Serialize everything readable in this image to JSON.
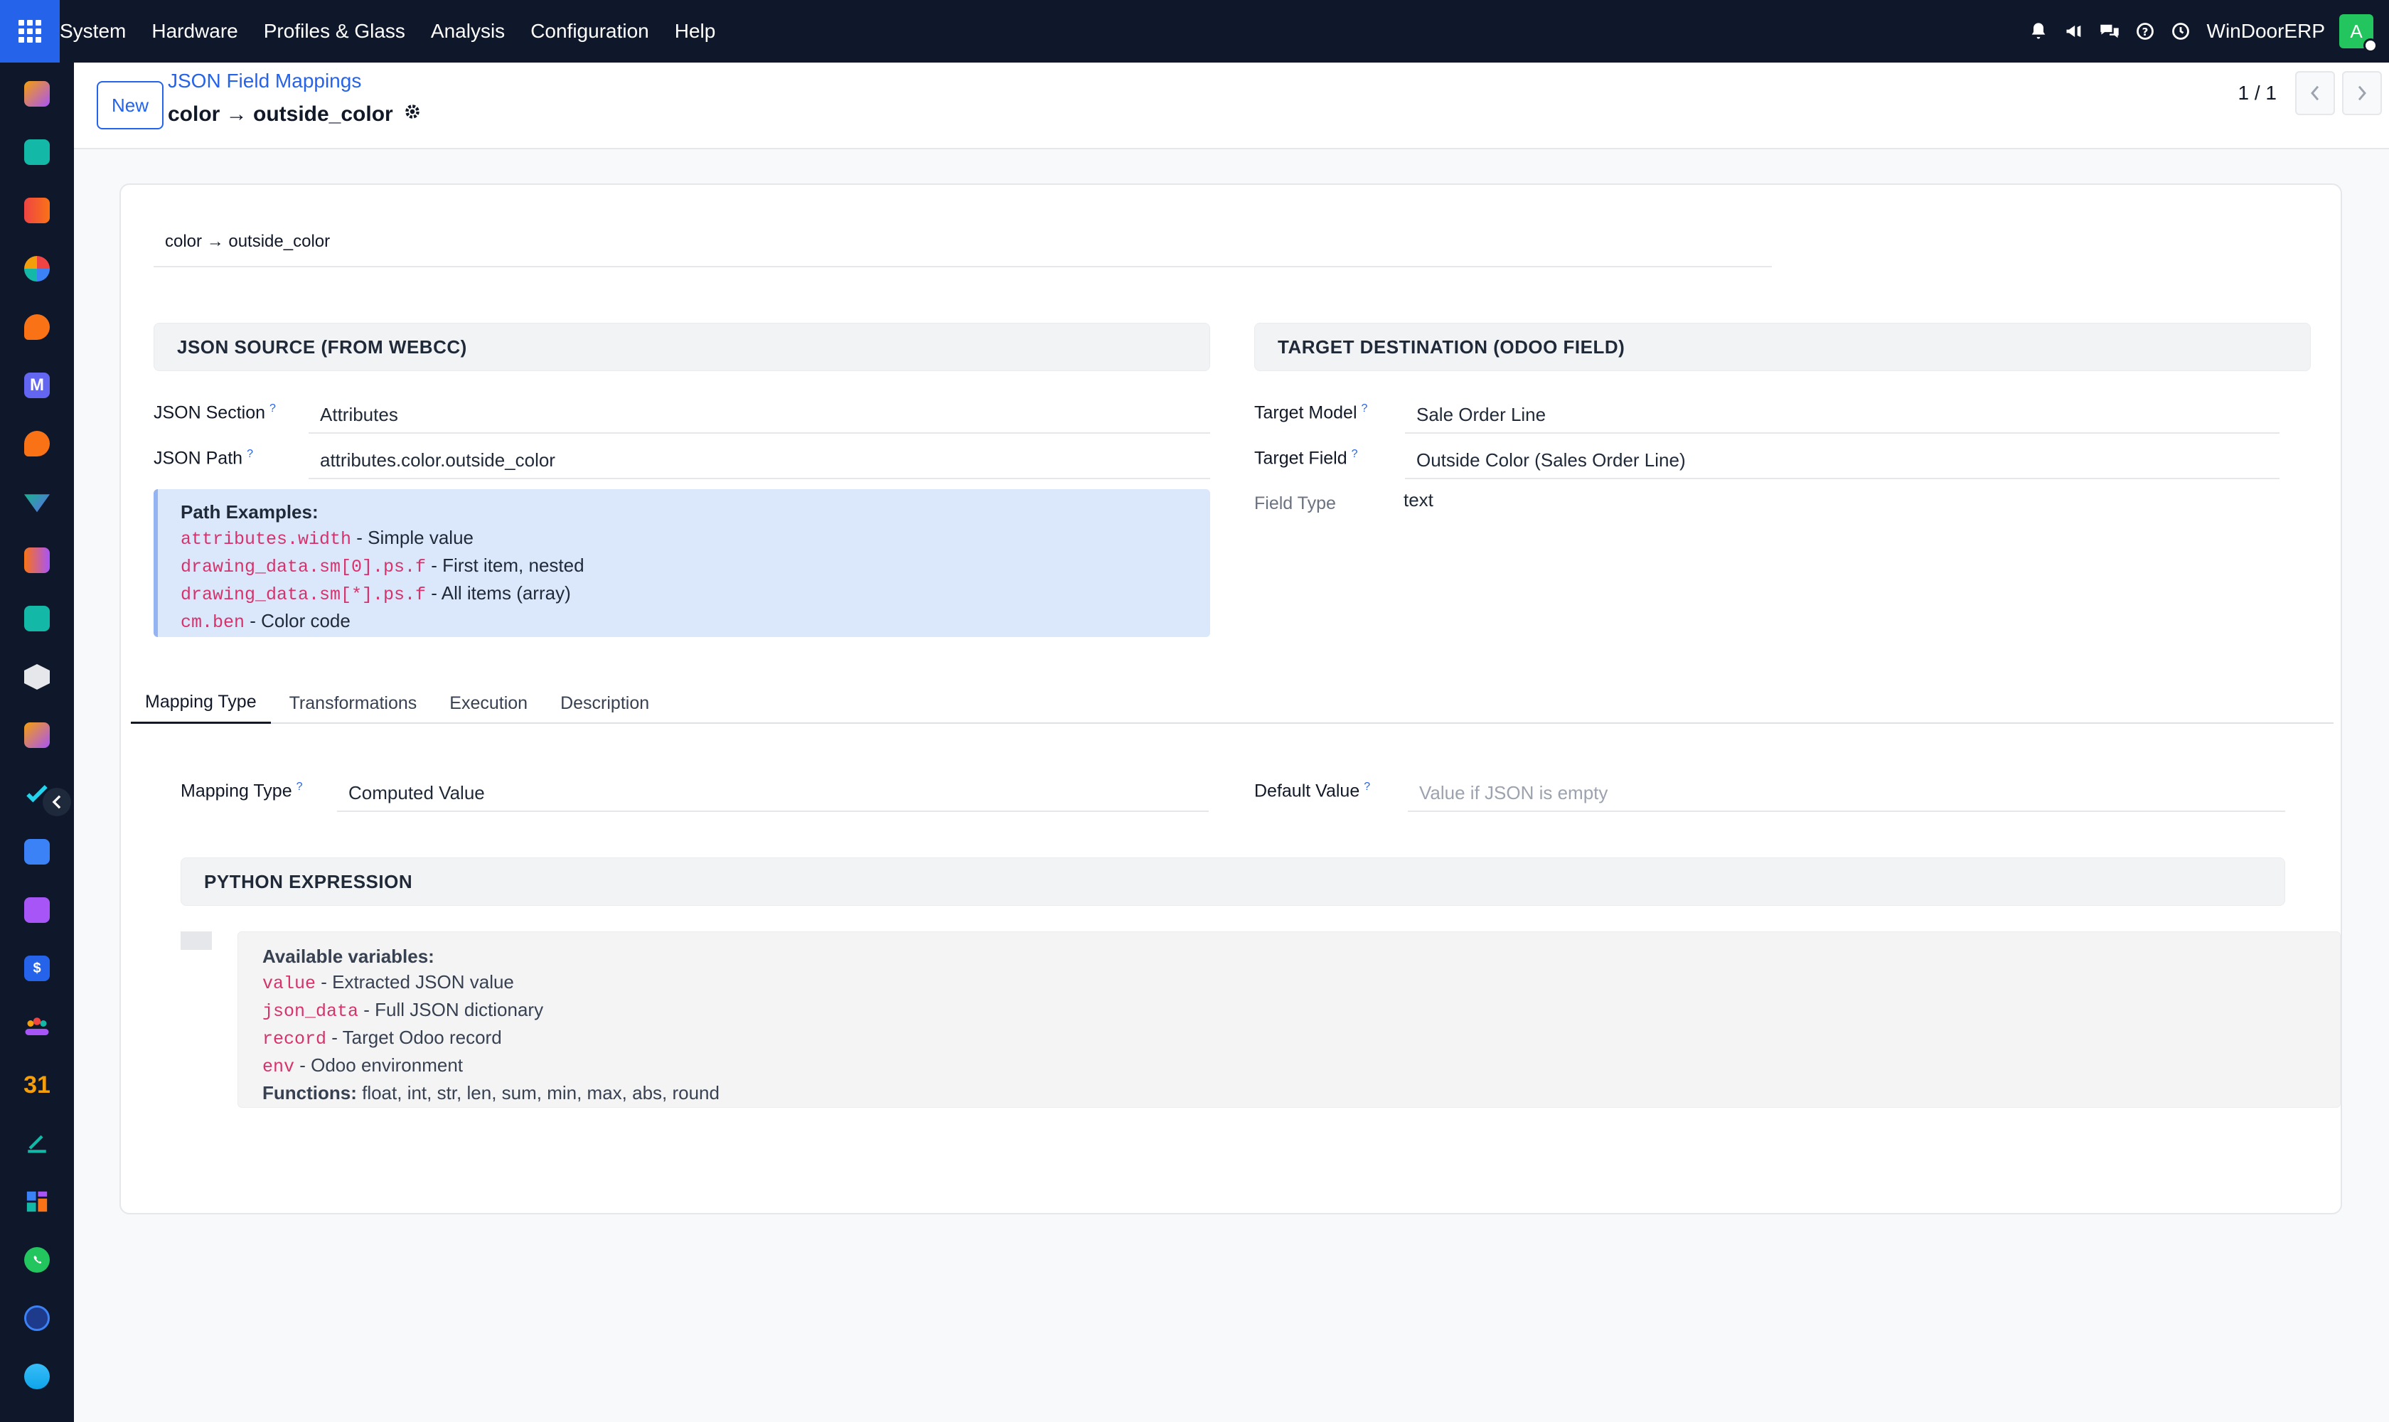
{
  "topbar": {
    "menu": [
      "System",
      "Hardware",
      "Profiles & Glass",
      "Analysis",
      "Configuration",
      "Help"
    ],
    "company": "WinDoorERP",
    "avatar_initial": "A",
    "icons": [
      "bell-icon",
      "megaphone-icon",
      "chat-icon",
      "help-icon",
      "clock-icon"
    ]
  },
  "sidebar": {
    "apps": [
      {
        "name": "app-sales-icon",
        "color": "#f59e0b"
      },
      {
        "name": "app-contacts-icon",
        "color": "#14b8a6"
      },
      {
        "name": "app-reporting-icon",
        "color": "#f97316"
      },
      {
        "name": "app-analytics-icon",
        "color": "#ef4444"
      },
      {
        "name": "app-discuss-icon",
        "color": "#f97316"
      },
      {
        "name": "app-mail-icon",
        "color": "#6366f1"
      },
      {
        "name": "app-livechat-icon",
        "color": "#f97316"
      },
      {
        "name": "app-inventory-icon",
        "color": "#10b981"
      },
      {
        "name": "app-dashboard-icon",
        "color": "#f97316"
      },
      {
        "name": "app-employees-icon",
        "color": "#14b8a6"
      },
      {
        "name": "app-products-icon",
        "color": "#e5e7eb"
      },
      {
        "name": "app-studio-icon",
        "color": "#f59e0b"
      },
      {
        "name": "app-project-icon",
        "color": "#22d3ee"
      },
      {
        "name": "app-knowledge-icon",
        "color": "#3b82f6"
      },
      {
        "name": "app-manufacturing-icon",
        "color": "#a855f7"
      },
      {
        "name": "app-invoicing-icon",
        "color": "#2563eb"
      },
      {
        "name": "app-team-icon",
        "color": "#f59e0b"
      },
      {
        "name": "app-calendar-icon",
        "color": "#f59e0b"
      },
      {
        "name": "app-sign-icon",
        "color": "#14b8a6"
      },
      {
        "name": "app-website-icon",
        "color": "#3b82f6"
      },
      {
        "name": "app-whatsapp-icon",
        "color": "#22c55e"
      },
      {
        "name": "app-timer-icon",
        "color": "#3b82f6"
      },
      {
        "name": "app-swirl-icon",
        "color": "#0ea5e9"
      }
    ],
    "calendar_day": "31"
  },
  "control_panel": {
    "new_label": "New",
    "breadcrumb": "JSON Field Mappings",
    "title": "color → outside_color",
    "pager": "1 / 1"
  },
  "form": {
    "name": "color → outside_color",
    "source": {
      "heading": "JSON SOURCE (FROM WEBCC)",
      "section_label": "JSON Section",
      "section_value": "Attributes",
      "path_label": "JSON Path",
      "path_value": "attributes.color.outside_color",
      "examples_title": "Path Examples:",
      "examples": [
        {
          "code": "attributes.width",
          "desc": " - Simple value"
        },
        {
          "code": "drawing_data.sm[0].ps.f",
          "desc": " - First item, nested"
        },
        {
          "code": "drawing_data.sm[*].ps.f",
          "desc": " - All items (array)"
        },
        {
          "code": "cm.ben",
          "desc": " - Color code"
        }
      ]
    },
    "target": {
      "heading": "TARGET DESTINATION (ODOO FIELD)",
      "model_label": "Target Model",
      "model_value": "Sale Order Line",
      "field_label": "Target Field",
      "field_value": "Outside Color (Sales Order Line)",
      "type_label": "Field Type",
      "type_value": "text"
    },
    "tabs": [
      "Mapping Type",
      "Transformations",
      "Execution",
      "Description"
    ],
    "mapping": {
      "type_label": "Mapping Type",
      "type_value": "Computed Value",
      "default_label": "Default Value",
      "default_placeholder": "Value if JSON is empty",
      "python_heading": "PYTHON EXPRESSION",
      "vars_title": "Available variables:",
      "vars": [
        {
          "code": "value",
          "desc": " - Extracted JSON value"
        },
        {
          "code": "json_data",
          "desc": " - Full JSON dictionary"
        },
        {
          "code": "record",
          "desc": " - Target Odoo record"
        },
        {
          "code": "env",
          "desc": " - Odoo environment"
        }
      ],
      "functions_label": "Functions:",
      "functions_value": " float, int, str, len, sum, min, max, abs, round"
    }
  }
}
